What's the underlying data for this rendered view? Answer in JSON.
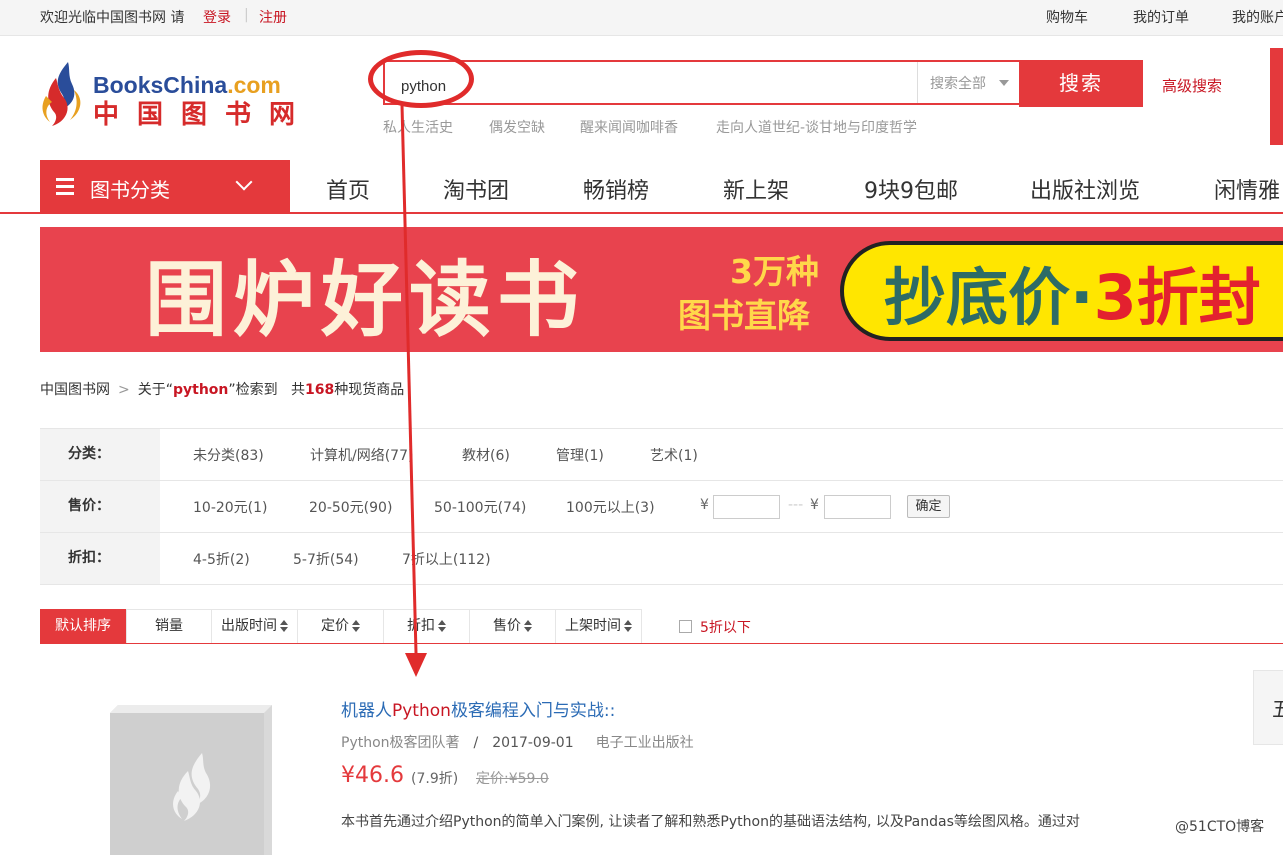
{
  "topbar": {
    "welcome": "欢迎光临中国图书网 请",
    "login": "登录",
    "divider": "|",
    "register": "注册",
    "cart": "购物车",
    "orders": "我的订单",
    "account": "我的账户"
  },
  "logo": {
    "english_main": "BooksChina",
    "english_dot": ".com",
    "chinese": "中国图书网"
  },
  "search": {
    "value": "python",
    "scope": "搜索全部",
    "button": "搜索",
    "advanced": "高级搜索",
    "hotwords": [
      "私人生活史",
      "偶发空缺",
      "醒来闻闻咖啡香",
      "走向人道世纪-谈甘地与印度哲学"
    ]
  },
  "nav": {
    "category_button": "图书分类",
    "items": [
      "首页",
      "淘书团",
      "畅销榜",
      "新上架",
      "9块9包邮",
      "出版社浏览",
      "闲情雅"
    ]
  },
  "banner": {
    "title": "围炉好读书",
    "sub1": "3万种",
    "sub2": "图书直降",
    "pill_a": "抄底价·",
    "pill_b": "3折封"
  },
  "breadcrumb": {
    "home": "中国图书网",
    "prefix": "关于“",
    "keyword": "python",
    "suffix": "”检索到",
    "total_prefix": "共",
    "count": "168",
    "total_suffix": "种现货商品"
  },
  "filters": {
    "category": {
      "label": "分类：",
      "options": [
        "未分类(83)",
        "计算机/网络(77)",
        "教材(6)",
        "管理(1)",
        "艺术(1)"
      ]
    },
    "price": {
      "label": "售价：",
      "options": [
        "10-20元(1)",
        "20-50元(90)",
        "50-100元(74)",
        "100元以上(3)"
      ],
      "currency": "¥",
      "range_sep": "---",
      "confirm": "确定"
    },
    "discount": {
      "label": "折扣：",
      "options": [
        "4-5折(2)",
        "5-7折(54)",
        "7折以上(112)"
      ]
    }
  },
  "sort": {
    "buttons": [
      "默认排序",
      "销量",
      "出版时间",
      "定价",
      "折扣",
      "售价",
      "上架时间"
    ],
    "checkbox_label": "5折以下"
  },
  "product": {
    "title_a": "机器人",
    "title_kw": "Python",
    "title_b": "极客编程入门与实战::",
    "author": "Python极客团队著",
    "slash": "/",
    "date": "2017-09-01",
    "publisher": "电子工业出版社",
    "price": "¥46.6",
    "discount": "(7.9折)",
    "list_price": "定价:¥59.0",
    "description": "本书首先通过介绍Python的简单入门案例, 让读者了解和熟悉Python的基础语法结构, 以及Pandas等绘图风格。通过对"
  },
  "side_panel": {
    "text": "五"
  },
  "watermark": "@51CTO博客",
  "colors": {
    "accent": "#e4393c",
    "link": "#2b6bb5",
    "annotation": "#e02b2b"
  }
}
